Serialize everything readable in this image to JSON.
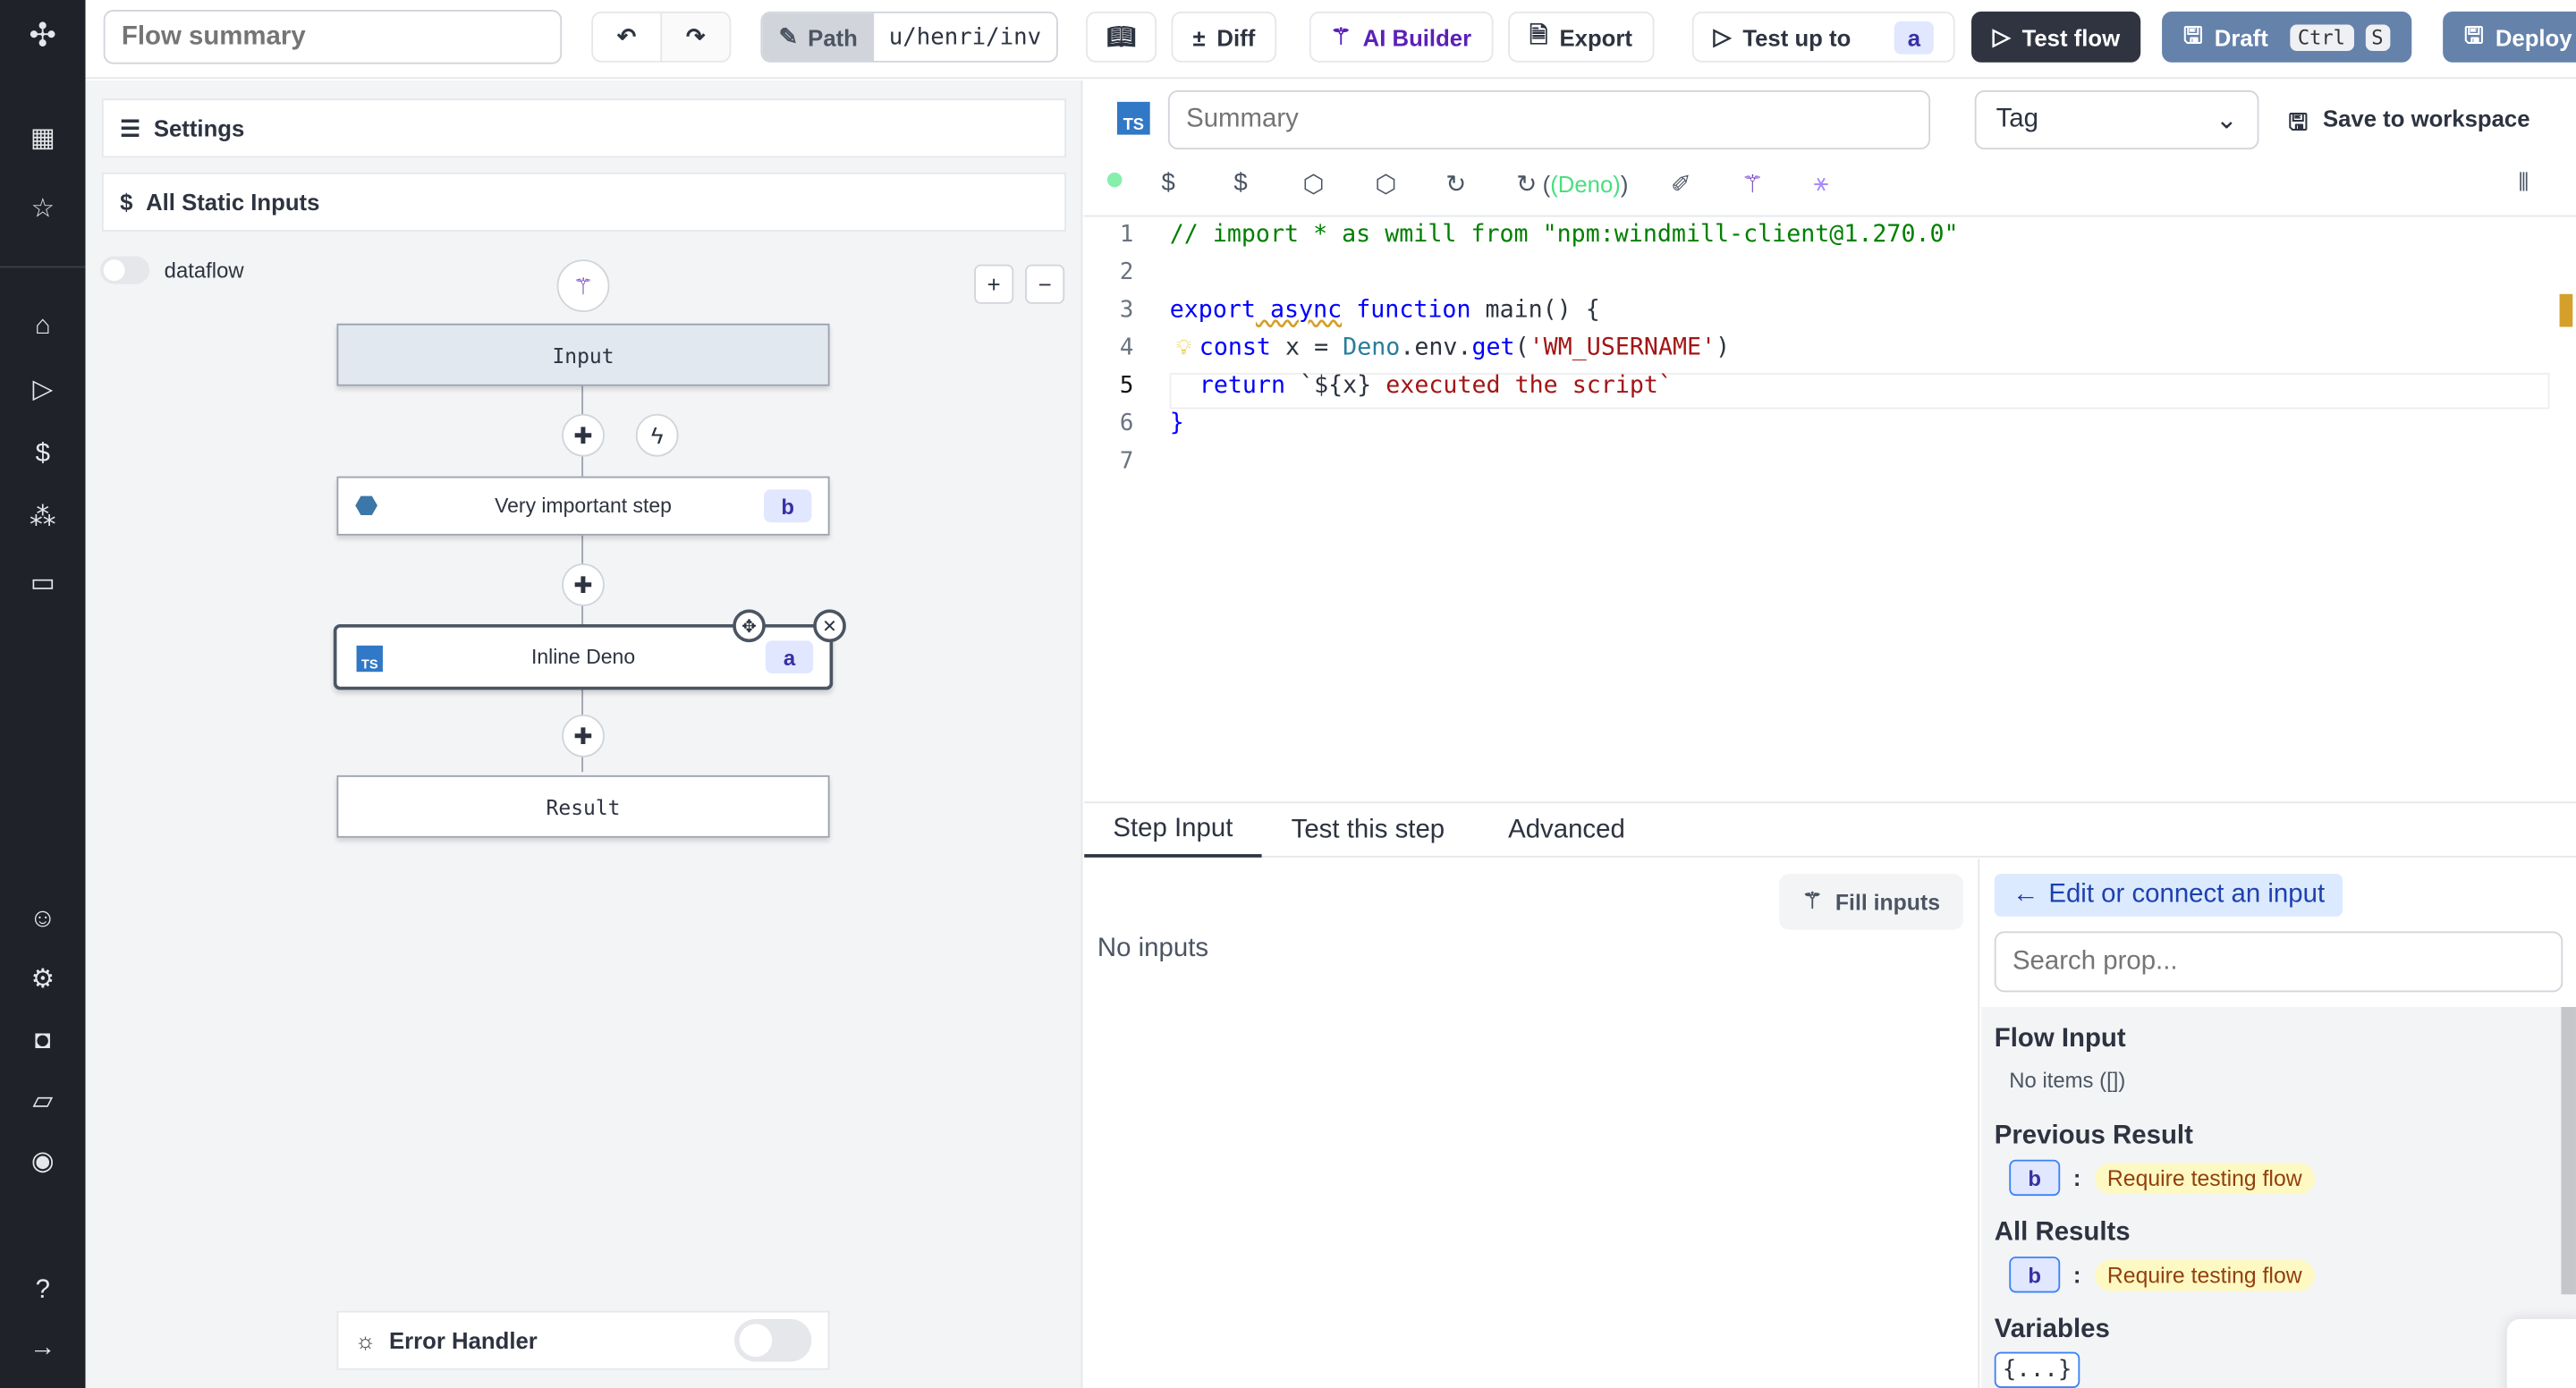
{
  "sidebar": {
    "icons": [
      "windmill-logo",
      "builder-icon",
      "star-icon",
      "home-icon",
      "play-icon",
      "dollar-icon",
      "resources-icon",
      "calendar-icon",
      "user-icon",
      "settings-icon",
      "bot-icon",
      "folder-icon",
      "eye-icon",
      "help-icon",
      "arrow-right-icon"
    ]
  },
  "toolbar": {
    "summary_placeholder": "Flow summary",
    "path_label": "Path",
    "path_value": "u/henri/inv",
    "diff": "Diff",
    "ai_builder": "AI Builder",
    "export": "Export",
    "test_up_to": "Test up to",
    "test_up_to_badge": "a",
    "test_flow": "Test flow",
    "draft": "Draft",
    "kbd_ctrl": "Ctrl",
    "kbd_s": "S",
    "deploy": "Deploy"
  },
  "left": {
    "settings": "Settings",
    "static_inputs": "All Static Inputs",
    "dataflow": "dataflow",
    "nodes": {
      "input": "Input",
      "step1": "Very important step",
      "step1_badge": "b",
      "step2": "Inline Deno",
      "step2_badge": "a",
      "result": "Result"
    },
    "error_handler": "Error Handler"
  },
  "editor": {
    "summary_placeholder": "Summary",
    "tag_placeholder": "Tag",
    "save_workspace": "Save to workspace",
    "runtime": "(Deno)",
    "lines": [
      "1",
      "2",
      "3",
      "4",
      "5",
      "6",
      "7"
    ],
    "code": {
      "l1": "// import * as wmill from \"npm:windmill-client@1.270.0\"",
      "l3a": "export",
      "l3b": " async",
      "l3c": " function",
      "l3d": " main() {",
      "l4a": "const",
      "l4b": " x = ",
      "l4c": "Deno",
      "l4d": ".env.",
      "l4e": "get",
      "l4f": "(",
      "l4g": "'WM_USERNAME'",
      "l4h": ")",
      "l5a": "return",
      "l5b": " `${x}",
      "l5c": " executed the script`",
      "l6": "}"
    }
  },
  "bottom": {
    "tabs": [
      "Step Input",
      "Test this step",
      "Advanced"
    ],
    "no_inputs": "No inputs",
    "fill_inputs": "Fill inputs",
    "edit_connect": "Edit or connect an input",
    "search_placeholder": "Search prop...",
    "flow_input": "Flow Input",
    "no_items": "No items ([])",
    "previous_result": "Previous Result",
    "all_results": "All Results",
    "badge_b": "b",
    "colon": ":",
    "require": "Require testing flow",
    "variables": "Variables",
    "vars_chip": "{...}"
  },
  "colors": {
    "sidebar": "#1f2228",
    "accent_blue": "#6582ab",
    "dark_button": "#2f3440",
    "ai_purple": "#5b21b6"
  }
}
